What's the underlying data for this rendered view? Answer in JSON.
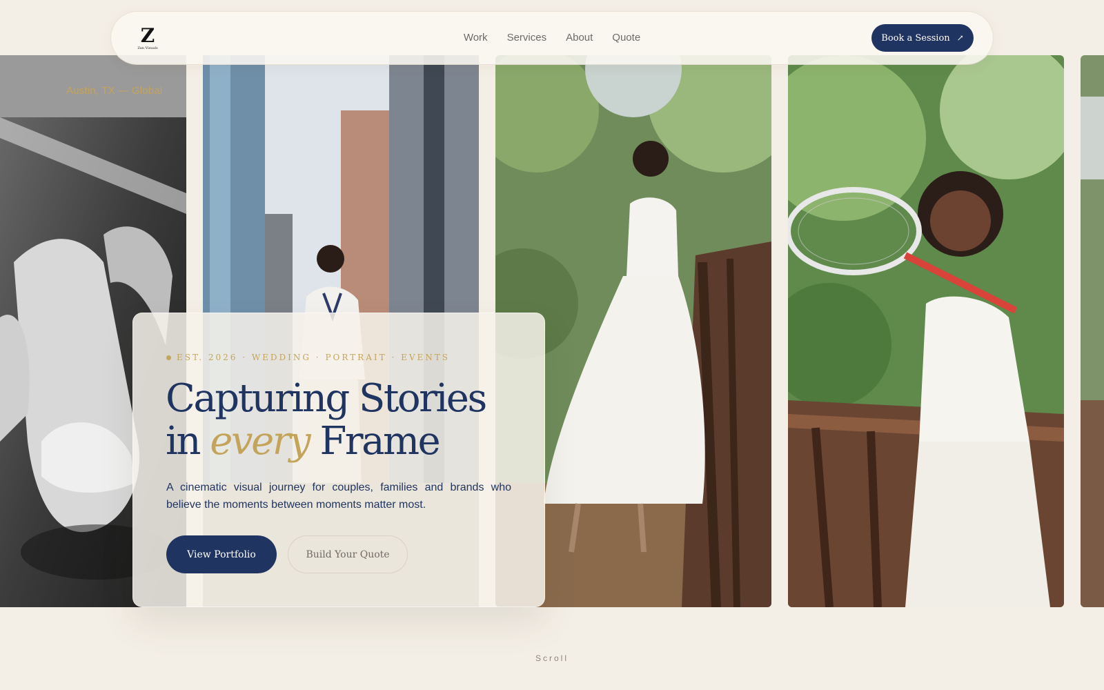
{
  "brand": {
    "logo_mark": "Z",
    "logo_sub": "Zan Visuals"
  },
  "nav": {
    "links": [
      "Work",
      "Services",
      "About",
      "Quote"
    ],
    "cta": "Book a Session"
  },
  "location": "Austin, TX — Global",
  "hero": {
    "eyebrow": "EST. 2026 · WEDDING · PORTRAIT · EVENTS",
    "headline_line1": "Capturing Stories",
    "headline_line2_start": "in",
    "headline_accent": "every",
    "headline_line2_end": "Frame",
    "lede": "A cinematic visual journey for couples, families and brands who believe the moments between moments matter most.",
    "primary_button": "View Portfolio",
    "secondary_button": "Build Your Quote"
  },
  "scroll_label": "Scroll",
  "colors": {
    "background": "#f4efe6",
    "navy": "#1f3460",
    "gold": "#c4a45a"
  },
  "icons": {
    "book_arrow": "arrow-up-right-icon"
  }
}
